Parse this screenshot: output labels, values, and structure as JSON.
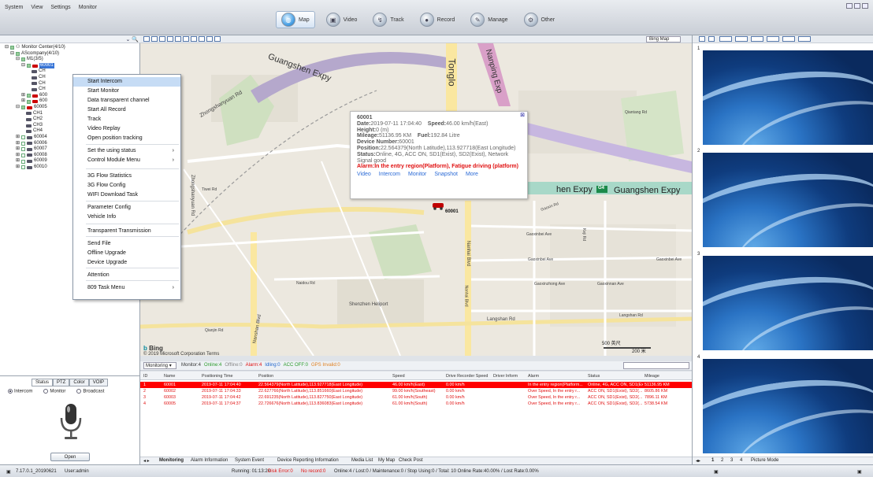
{
  "menu": [
    "System",
    "View",
    "Settings",
    "Monitor"
  ],
  "nav": [
    {
      "label": "Map",
      "icon": "globe-icon",
      "active": true
    },
    {
      "label": "Video",
      "icon": "camera-icon"
    },
    {
      "label": "Track",
      "icon": "track-icon"
    },
    {
      "label": "Record",
      "icon": "record-icon"
    },
    {
      "label": "Manage",
      "icon": "manage-icon"
    },
    {
      "label": "Other",
      "icon": "other-icon"
    }
  ],
  "tree": {
    "root": "Monitor Center(4/10)",
    "company": "AScompany(4/10)",
    "group": "M1(3/5)",
    "selected": "60001",
    "channels_a": [
      "CH",
      "CH",
      "CH",
      "CH"
    ],
    "devices_a": [
      "600",
      "600"
    ],
    "device_60005": "60005",
    "channels_b": [
      "CH1",
      "CH2",
      "CH3",
      "CH4"
    ],
    "devices_b": [
      "60004",
      "60006",
      "60007",
      "60008",
      "60009",
      "60010"
    ]
  },
  "context_menu": [
    {
      "label": "Start Intercom",
      "highlight": true
    },
    {
      "label": "Start Monitor"
    },
    {
      "label": "Data transparent channel"
    },
    {
      "label": "Start All Record"
    },
    {
      "label": "Track"
    },
    {
      "label": "Video Replay"
    },
    {
      "label": "Open position tracking"
    },
    {
      "label": "Set the using status",
      "sub": true
    },
    {
      "label": "Control Module Menu",
      "sub": true
    },
    {
      "label": "3G Flow Statistics"
    },
    {
      "label": "3G Flow Config"
    },
    {
      "label": "WIFI Download Task"
    },
    {
      "label": "Parameter Config"
    },
    {
      "label": "Vehicle Info"
    },
    {
      "label": "Transparent Transmission"
    },
    {
      "label": "Send File"
    },
    {
      "label": "Offline Upgrade"
    },
    {
      "label": "Device Upgrade"
    },
    {
      "label": "Attention"
    },
    {
      "label": "809 Task Menu",
      "sub": true
    }
  ],
  "voice": {
    "tabs": [
      "Status",
      "PTZ",
      "Color",
      "VOIP"
    ],
    "modes": [
      "Intercom",
      "Monitor",
      "Broadcast"
    ],
    "open": "Open"
  },
  "map": {
    "provider": "Bing Map",
    "roads": [
      "Guangshen Expy",
      "Tonglo",
      "Nanping Exp",
      "Zhongshanyuan Rd",
      "Tiwei Rd",
      "Zhongshanyuan Rd",
      "Naidou Rd",
      "Shenzhen Heliport",
      "Qianjin Rd",
      "Nanshan Blvd",
      "Nanhai Blvd",
      "Gaoxinbei Ave",
      "Gaoxinbei Ave",
      "Gaoxinbei Ave",
      "Gaoxinzhong Ave",
      "Gaoxinnan Ave",
      "Langshan Rd",
      "Langshan Rd",
      "Gaoxin Rd",
      "Keji Rd",
      "Qiantang Rd",
      "Guangshen Expy",
      "Nanhai Blvd"
    ],
    "scale_km": "500 英尺",
    "scale_m": "200 米",
    "logo": "Bing",
    "copyright": "© 2019 Microsoft Corporation Terms",
    "vehicle_label": "60001",
    "shield": "G4"
  },
  "popup": {
    "id": "60001",
    "date_label": "Date:",
    "date": "2019-07-11 17:04:40",
    "speed_label": "Speed:",
    "speed": "46.00 km/h(East)",
    "height_label": "Height:",
    "height": "0 (m)",
    "mileage_label": "Mileage:",
    "mileage": "51136.95 KM",
    "fuel_label": "Fuel:",
    "fuel": "192.84 Litre",
    "devnum_label": "Device Number:",
    "devnum": "60001",
    "pos_label": "Position:",
    "pos": "22.564379(North Latitude),113.927718(East Longitude)",
    "status_label": "Status:",
    "status": "Online, 4G, ACC ON, SD1(Exist), SD2(Exist), Network Signal good",
    "alarm_label": "Alarm:",
    "alarm": "In the entry region(Platform), Fatigue driving (platform)",
    "links": [
      "Video",
      "Intercom",
      "Monitor",
      "Snapshot",
      "More"
    ]
  },
  "monitor": {
    "select": "Monitoring",
    "stats": [
      "Monitor:4",
      "Online:4",
      "Offline:0",
      "Alarm:4",
      "Idling:0",
      "ACC OFF:0",
      "GPS Invalid:0"
    ],
    "stat_colors": [
      "#333",
      "#2a9a2a",
      "#888",
      "#e01010",
      "#2266cc",
      "#2a9a2a",
      "#e08020"
    ]
  },
  "table": {
    "headers": [
      "ID",
      "Name",
      "Positioning Time",
      "Position",
      "Speed",
      "Drive Recorder Speed",
      "Driver Inform",
      "Alarm",
      "Status",
      "Mileage"
    ],
    "rows": [
      [
        "1",
        "60001",
        "2019-07-11 17:04:40",
        "22.564379(North Latitude),113.927718(East Longitude)",
        "46.00 km/h(East)",
        "0.00 km/h",
        "",
        "In the entry region(Platform...",
        "Online, 4G, ACC ON, SD1(Exist), SD2(...",
        "51136.95 KM"
      ],
      [
        "2",
        "60002",
        "2019-07-11 17:04:33",
        "22.627766(North Latitude),113.851660(East Longitude)",
        "99.00 km/h(Southeast)",
        "0.00 km/h",
        "",
        "Over Speed, In the entry r...",
        "ACC ON, SD1(Exist), SD2(...",
        "8605.86 KM"
      ],
      [
        "3",
        "60003",
        "2019-07-11 17:04:42",
        "22.691235(North Latitude),113.827750(East Longitude)",
        "61.00 km/h(South)",
        "0.00 km/h",
        "",
        "Over Speed, In the entry r...",
        "ACC ON, SD1(Exist), SD2(...",
        "7896.11 KM"
      ],
      [
        "4",
        "60005",
        "2019-07-11 17:04:37",
        "22.726676(North Latitude),113.836083(East Longitude)",
        "61.00 km/h(South)",
        "0.00 km/h",
        "",
        "Over Speed, In the entry r...",
        "ACC ON, SD1(Exist), SD2(...",
        "5738.54 KM"
      ]
    ]
  },
  "bottom_tabs": [
    "Monitoring",
    "Alarm Information",
    "System Event",
    "Device Reporting Information",
    "Media List",
    "My Map",
    "Check Post"
  ],
  "right": {
    "panes": [
      "1",
      "2",
      "3",
      "4"
    ],
    "pages": [
      "1",
      "2",
      "3",
      "4"
    ],
    "mode": "Picture Mode"
  },
  "status": {
    "version": "7.17.0.1_20190621",
    "user": "User:admin",
    "running": "Running: 01:13:20",
    "disk": "Disk Error:0",
    "norecord": "No record:0",
    "rest": "Online:4 / Lost:0 / Maintenance:0 / Stop Using:0 / Total: 10    Online Rate:40.00% / Lost Rate:0.00%"
  },
  "colors": {
    "alarm_row": "#ff0000",
    "alarm_text": "#e01010",
    "link": "#2a6ad6",
    "accent": "#4da3e6"
  }
}
